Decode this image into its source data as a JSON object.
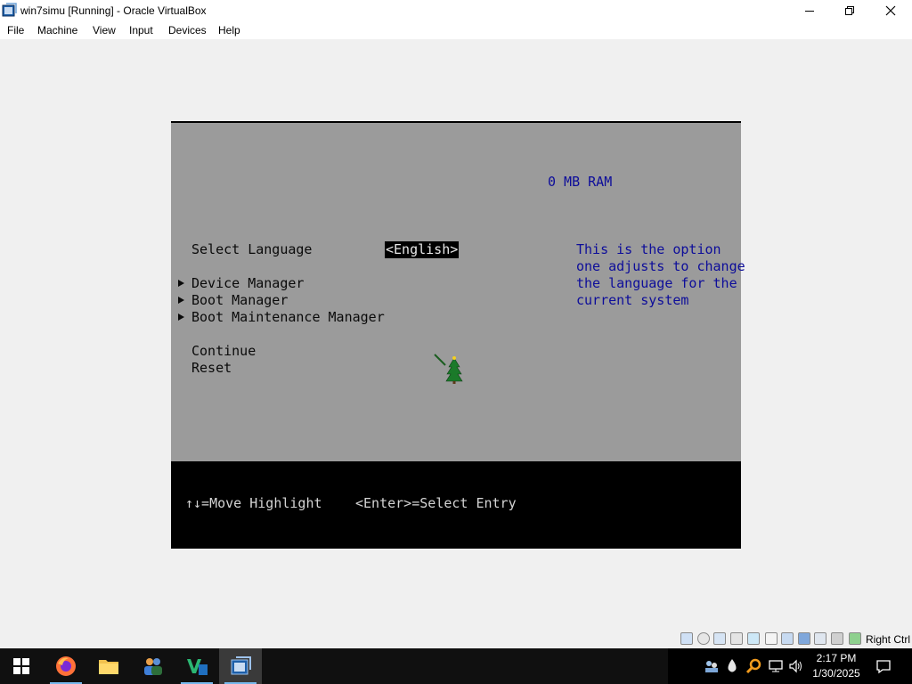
{
  "window": {
    "title": "win7simu [Running] - Oracle VirtualBox"
  },
  "menubar": {
    "items": [
      "File",
      "Machine",
      "View",
      "Input",
      "Devices",
      "Help"
    ]
  },
  "bios": {
    "ram_label": "0 MB RAM",
    "select_language_label": "Select Language",
    "language_value": "<English>",
    "help_lines": [
      "This is the option",
      "one adjusts to change",
      "the language for the",
      "current system"
    ],
    "submenu_items": [
      "Device Manager",
      "Boot Manager",
      "Boot Maintenance Manager"
    ],
    "actions": [
      "Continue",
      "Reset"
    ],
    "footer_move": "↑↓=Move Highlight",
    "footer_select": "<Enter>=Select Entry",
    "colors": {
      "background": "#9b9b9b",
      "help_text": "#0d0d9a",
      "footer": "#000000"
    }
  },
  "statusbar": {
    "host_key": "Right Ctrl",
    "indicator_icons": [
      "hard-disk-icon",
      "optical-drive-icon",
      "floppy-icon",
      "audio-icon",
      "network-icon",
      "usb-icon",
      "shared-folder-icon",
      "display-icon",
      "video-capture-icon",
      "recording-icon",
      "cpu-icon",
      "mouse-integration-icon",
      "keyboard-icon"
    ]
  },
  "taskbar": {
    "apps": [
      "firefox-icon",
      "file-explorer-icon",
      "people-icon",
      "visual-studio-icon",
      "virtualbox-icon"
    ],
    "tray_icons": [
      "network-sharing-icon",
      "water-drop-icon",
      "search-tray-icon",
      "monitor-network-icon",
      "volume-icon"
    ],
    "clock_time": "2:17 PM",
    "clock_date": "1/30/2025"
  }
}
